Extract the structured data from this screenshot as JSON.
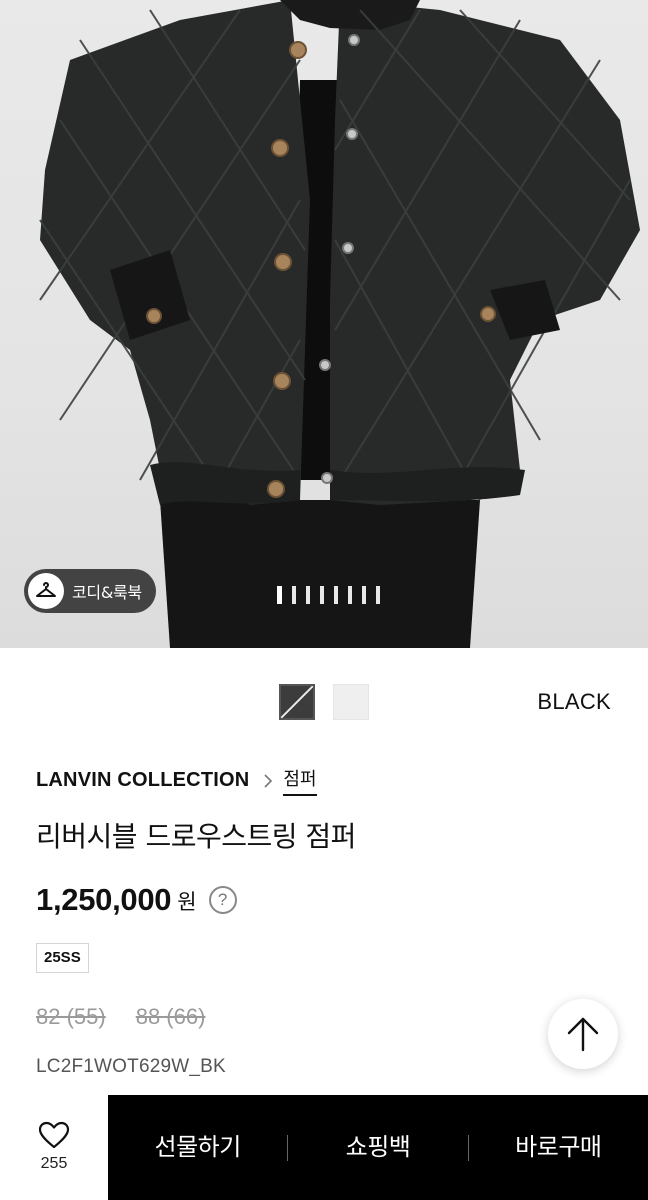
{
  "hero": {
    "codi_label": "코디&룩북",
    "page_indicator": {
      "total": 8,
      "current": 1
    }
  },
  "colors": {
    "swatches": [
      {
        "name": "dark-swatch",
        "hex": "#3c3c3c",
        "selected": true
      },
      {
        "name": "light-swatch",
        "hex": "#efefef",
        "selected": false
      }
    ],
    "selected_name": "BLACK"
  },
  "product": {
    "brand": "LANVIN COLLECTION",
    "category": "점퍼",
    "title": "리버시블 드로우스트링 점퍼",
    "price": "1,250,000",
    "currency": "원",
    "info_icon": "?",
    "season": "25SS",
    "sizes": [
      "82 (55)",
      "88 (66)"
    ],
    "code": "LC2F1WOT629W_BK"
  },
  "bottom_bar": {
    "wish_count": "255",
    "gift_label": "선물하기",
    "bag_label": "쇼핑백",
    "buy_label": "바로구매"
  },
  "icons": {
    "codi": "hanger-icon",
    "chevron": "chevron-right-icon",
    "info": "question-circle-icon",
    "scroll": "arrow-up-icon",
    "wish": "heart-icon"
  }
}
